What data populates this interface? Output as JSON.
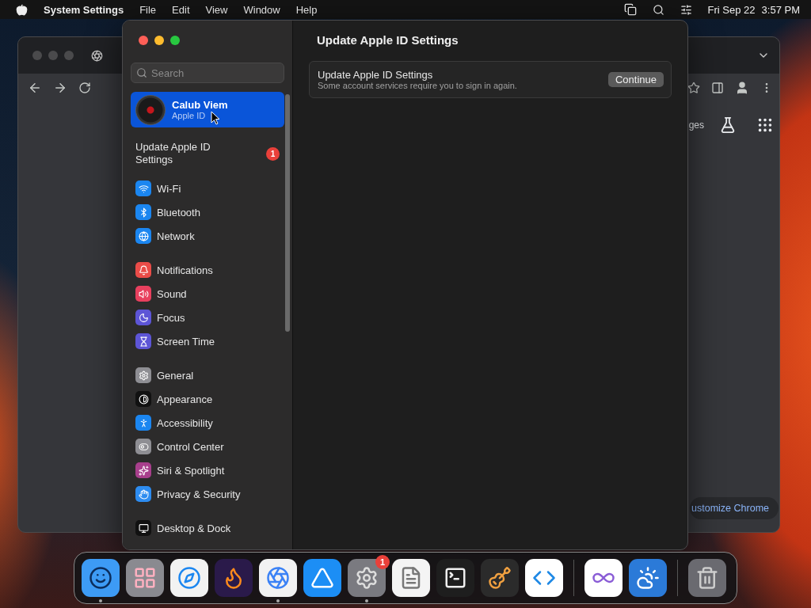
{
  "menubar": {
    "app": "System Settings",
    "menus": [
      "File",
      "Edit",
      "View",
      "Window",
      "Help"
    ],
    "date": "Fri Sep 22",
    "time": "3:57 PM"
  },
  "browser": {
    "link": "ges",
    "button": "ustomize Chrome"
  },
  "settings": {
    "search": {
      "placeholder": "Search"
    },
    "account": {
      "name": "Calub Viem",
      "subtitle": "Apple ID",
      "selected": true
    },
    "notice": {
      "label": "Update Apple ID Settings",
      "badge": "1",
      "selected": false
    },
    "groups": [
      {
        "items": [
          {
            "label": "Wi-Fi",
            "color": "#1b86f0",
            "selected": false
          },
          {
            "label": "Bluetooth",
            "color": "#1b86f0",
            "selected": false
          },
          {
            "label": "Network",
            "color": "#1b86f0",
            "selected": false
          }
        ]
      },
      {
        "items": [
          {
            "label": "Notifications",
            "color": "#ea4c48",
            "selected": false
          },
          {
            "label": "Sound",
            "color": "#e8405e",
            "selected": false
          },
          {
            "label": "Focus",
            "color": "#5d55d6",
            "selected": false
          },
          {
            "label": "Screen Time",
            "color": "#5d55d6",
            "selected": false
          }
        ]
      },
      {
        "items": [
          {
            "label": "General",
            "color": "#8e8e93",
            "selected": false
          },
          {
            "label": "Appearance",
            "color": "#111111",
            "selected": false
          },
          {
            "label": "Accessibility",
            "color": "#1b86f0",
            "selected": false
          },
          {
            "label": "Control Center",
            "color": "#8e8e93",
            "selected": false
          },
          {
            "label": "Siri & Spotlight",
            "color": "#a83f8c",
            "selected": false
          },
          {
            "label": "Privacy & Security",
            "color": "#2d8cf0",
            "selected": false
          }
        ]
      },
      {
        "items": [
          {
            "label": "Desktop & Dock",
            "color": "#111111",
            "selected": false
          }
        ]
      }
    ],
    "page": {
      "title": "Update Apple ID Settings",
      "card": {
        "title": "Update Apple ID Settings",
        "subtitle": "Some account services require you to sign in again.",
        "button": "Continue"
      }
    }
  },
  "dock": {
    "apps": [
      {
        "color": "#3d9bf5",
        "running": true
      },
      {
        "color": "#8a8a90",
        "running": false
      },
      {
        "color": "#f2f2f2",
        "running": false
      },
      {
        "color": "#2a1a4a",
        "running": false
      },
      {
        "color": "#f2f2f2",
        "running": true
      },
      {
        "color": "#1c8ef5",
        "running": false
      },
      {
        "color": "#7a7a80",
        "running": true,
        "badge": "1"
      },
      {
        "color": "#f4f4f4",
        "running": false
      },
      {
        "color": "#1e1e1e",
        "running": false
      },
      {
        "color": "#2b2b2b",
        "running": false
      },
      {
        "color": "#ffffff",
        "running": false
      },
      {
        "color": "#ffffff",
        "running": false
      },
      {
        "color": "#2b7ad8",
        "running": false
      },
      {
        "color": "#6a6a70",
        "running": false
      }
    ]
  }
}
